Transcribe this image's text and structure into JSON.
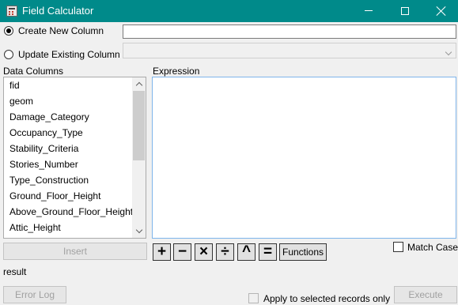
{
  "window": {
    "title": "Field Calculator",
    "icon": "calculator-icon"
  },
  "create_new_column": {
    "label": "Create New Column",
    "value": "",
    "selected": true
  },
  "update_existing_column": {
    "label": "Update Existing Column",
    "selected_value": "",
    "selected": false
  },
  "data_columns": {
    "label": "Data Columns",
    "items": [
      "fid",
      "geom",
      "Damage_Category",
      "Occupancy_Type",
      "Stability_Criteria",
      "Stories_Number",
      "Type_Construction",
      "Ground_Floor_Height",
      "Above_Ground_Floor_Height",
      "Attic_Height"
    ]
  },
  "expression": {
    "label": "Expression",
    "value": ""
  },
  "buttons": {
    "insert": "Insert",
    "operators": [
      "+",
      "−",
      "×",
      "÷",
      "^",
      "="
    ],
    "functions": "Functions",
    "error_log": "Error Log",
    "execute": "Execute"
  },
  "match_case": {
    "label": "Match Case",
    "checked": false
  },
  "result_label": "result",
  "apply_selected": {
    "label": "Apply to selected records only",
    "checked": false
  },
  "colors": {
    "titlebar": "#008a8a",
    "expression_focus_border": "#7eb4ea"
  }
}
